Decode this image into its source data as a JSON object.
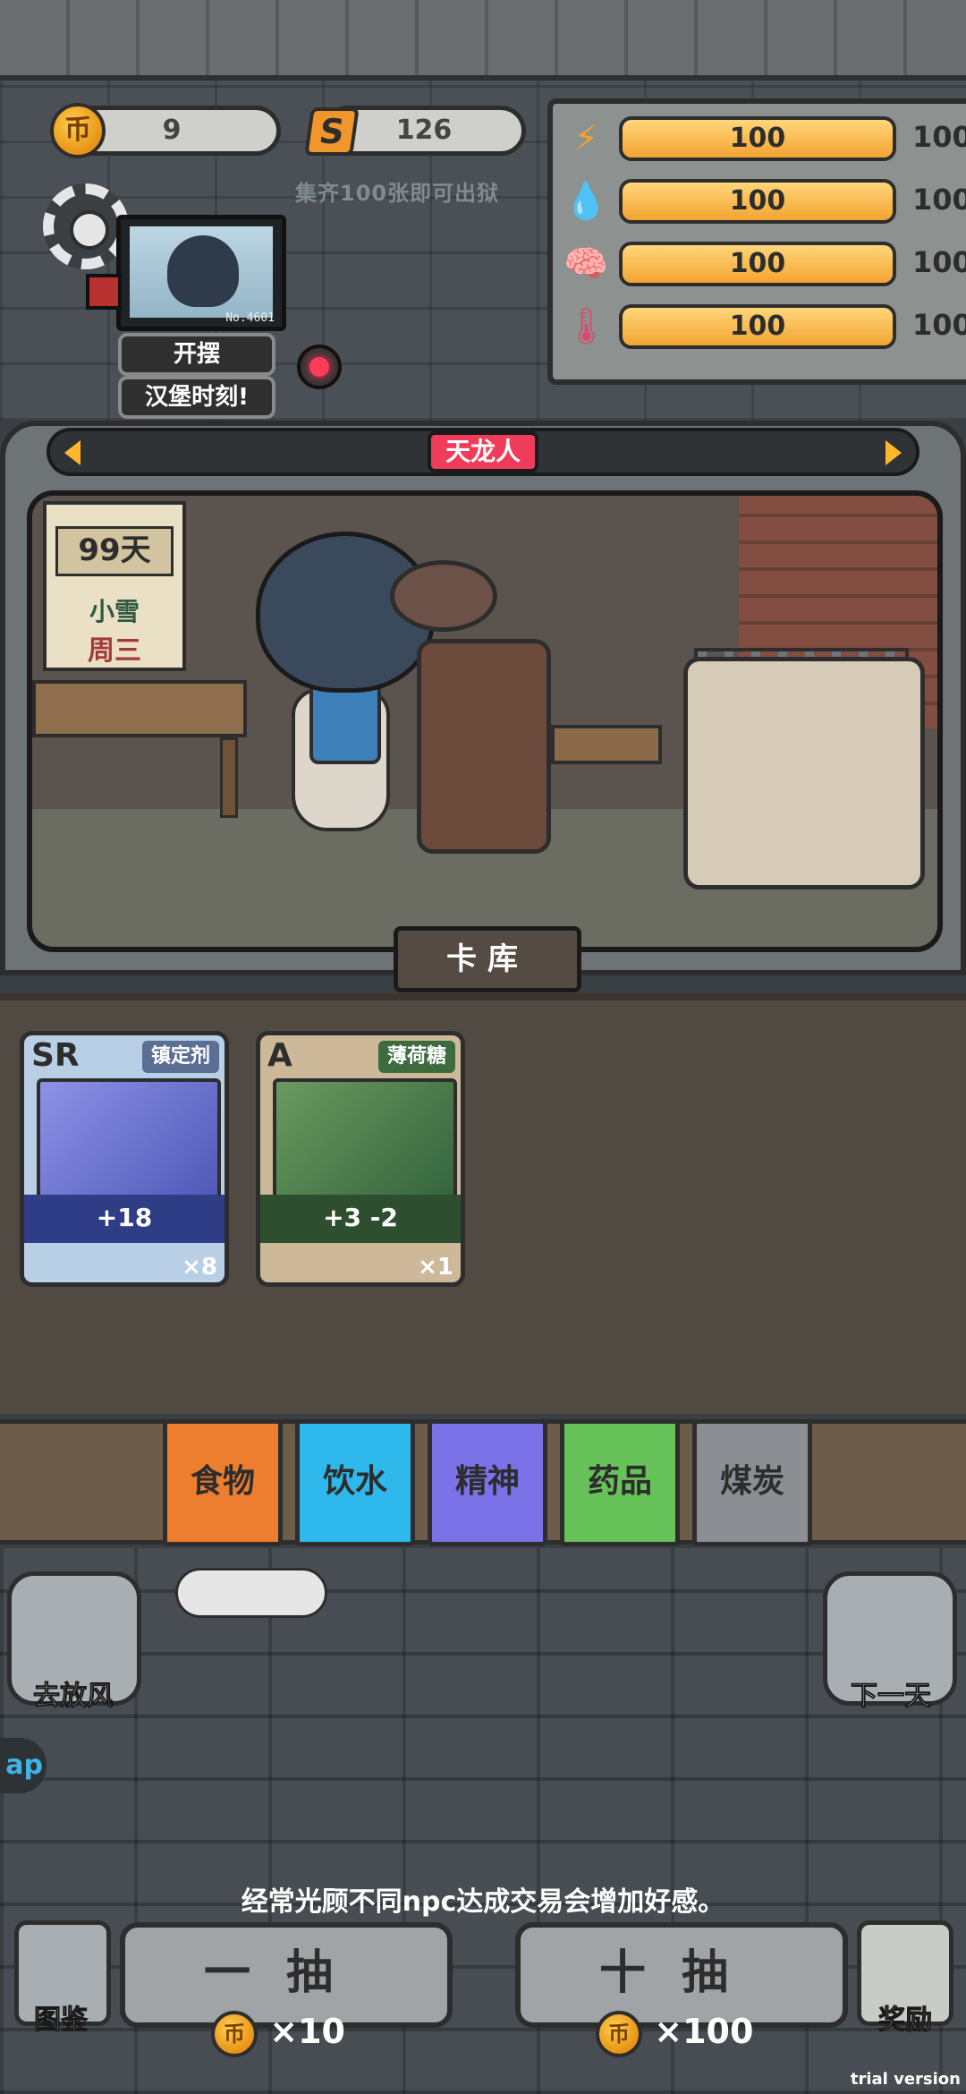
{
  "currency": {
    "coins": "9",
    "coin_icon_glyph": "币",
    "stamps": "126",
    "stamp_icon_glyph": "S",
    "collect_hint": "集齐100张即可出狱"
  },
  "stats": [
    {
      "icon": "lightning-icon",
      "glyph": "⚡",
      "value": "100",
      "max": "100",
      "level": 1.0,
      "color": "#f2a230"
    },
    {
      "icon": "water-drop-icon",
      "glyph": "💧",
      "value": "100",
      "max": "100",
      "level": 1.0,
      "color": "#3aa0e6"
    },
    {
      "icon": "brain-icon",
      "glyph": "🧠",
      "value": "100",
      "max": "100",
      "level": 1.0,
      "color": "#7a6cf2"
    },
    {
      "icon": "thermometer-icon",
      "glyph": "🌡",
      "value": "100",
      "max": "100",
      "level": 1.0,
      "color": "#e2456d"
    }
  ],
  "monitor": {
    "number": "No.4601"
  },
  "actions": {
    "slack": "开摆",
    "burger_time": "汉堡时刻!"
  },
  "character": {
    "name": "天龙人"
  },
  "calendar": {
    "days": "99天",
    "weather": "小雪",
    "weekday": "周三"
  },
  "card_library": {
    "title": "卡库"
  },
  "cards": [
    {
      "rank": "SR",
      "name": "镇定剂",
      "effect": "+18",
      "count": "×8",
      "color": "#4d63c9"
    },
    {
      "rank": "A",
      "name": "薄荷糖",
      "effect": "+3  -2",
      "count": "×1",
      "color": "#3e6b3e"
    }
  ],
  "categories": [
    {
      "label": "食物",
      "color": "#ee7e2f"
    },
    {
      "label": "饮水",
      "color": "#2fb8ec"
    },
    {
      "label": "精神",
      "color": "#7a72e6"
    },
    {
      "label": "药品",
      "color": "#67c25a"
    },
    {
      "label": "煤炭",
      "color": "#8b8e92"
    }
  ],
  "bottom": {
    "go_out": "去放风",
    "next_day": "下一天",
    "hint": "经常光顾不同npc达成交易会增加好感。",
    "gallery": "图鉴",
    "reward": "奖励",
    "draw_one": "一抽",
    "draw_one_price": "×10",
    "draw_ten": "十抽",
    "draw_ten_price": "×100",
    "left_badge": "ap",
    "trial": "trial version"
  }
}
